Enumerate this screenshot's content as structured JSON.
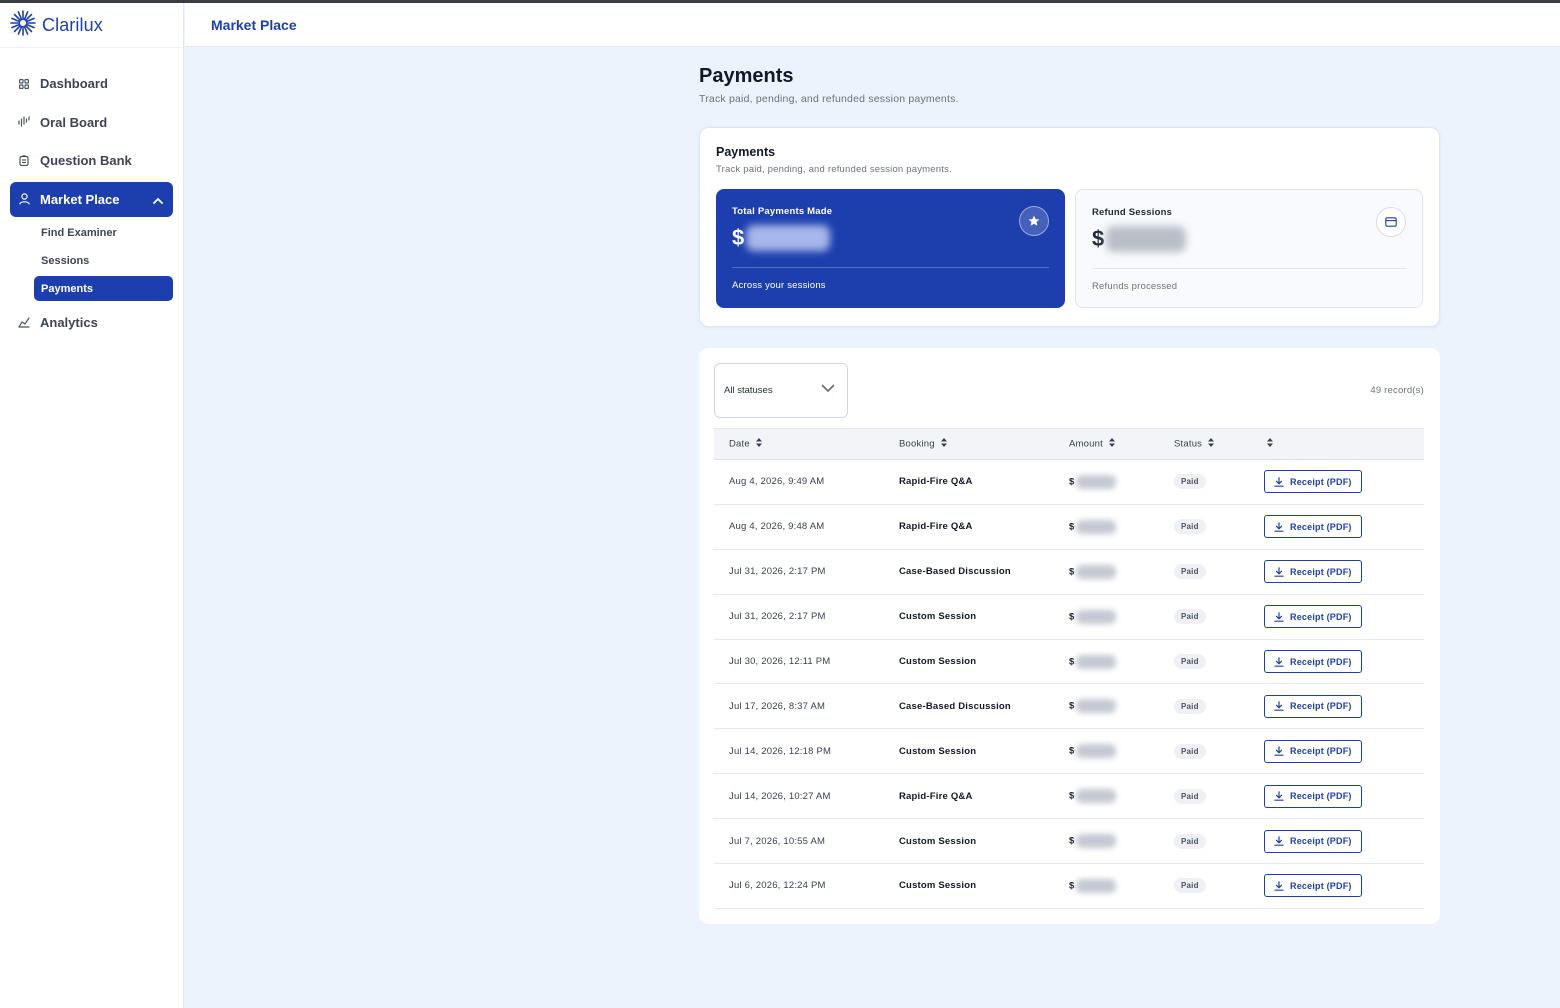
{
  "brand": {
    "name": "Clarilux",
    "logo_icon": "sunburst-logo-icon"
  },
  "sidebar": {
    "items": [
      {
        "label": "Dashboard",
        "icon": "grid-icon"
      },
      {
        "label": "Oral Board",
        "icon": "waveform-icon"
      },
      {
        "label": "Question Bank",
        "icon": "clipboard-icon"
      },
      {
        "label": "Market Place",
        "icon": "user-icon",
        "expanded": true
      },
      {
        "label": "Analytics",
        "icon": "analytics-icon"
      }
    ],
    "subitems": [
      {
        "label": "Find Examiner"
      },
      {
        "label": "Sessions"
      },
      {
        "label": "Payments",
        "active": true
      }
    ]
  },
  "header": {
    "title": "Market Place"
  },
  "page": {
    "title": "Payments",
    "subtitle": "Track paid, pending, and refunded session payments."
  },
  "summary": {
    "title": "Payments",
    "subtitle": "Track paid, pending, and refunded session payments.",
    "total": {
      "label": "Total Payments Made",
      "currency": "$",
      "foot": "Across your sessions",
      "icon": "star-icon"
    },
    "refund": {
      "label": "Refund Sessions",
      "currency": "$",
      "foot": "Refunds processed",
      "icon": "card-icon"
    }
  },
  "filter": {
    "value": "All statuses",
    "records": "49 record(s)"
  },
  "table": {
    "headers": {
      "date": "Date",
      "booking": "Booking",
      "amount": "Amount",
      "status": "Status"
    },
    "rows": [
      {
        "date": "Aug 4, 2026, 9:49 AM",
        "booking": "Rapid-Fire Q&A",
        "currency": "$",
        "status": "Paid",
        "action": "Receipt (PDF)"
      },
      {
        "date": "Aug 4, 2026, 9:48 AM",
        "booking": "Rapid-Fire Q&A",
        "currency": "$",
        "status": "Paid",
        "action": "Receipt (PDF)"
      },
      {
        "date": "Jul 31, 2026, 2:17 PM",
        "booking": "Case-Based Discussion",
        "currency": "$",
        "status": "Paid",
        "action": "Receipt (PDF)"
      },
      {
        "date": "Jul 31, 2026, 2:17 PM",
        "booking": "Custom Session",
        "currency": "$",
        "status": "Paid",
        "action": "Receipt (PDF)"
      },
      {
        "date": "Jul 30, 2026, 12:11 PM",
        "booking": "Custom Session",
        "currency": "$",
        "status": "Paid",
        "action": "Receipt (PDF)"
      },
      {
        "date": "Jul 17, 2026, 8:37 AM",
        "booking": "Case-Based Discussion",
        "currency": "$",
        "status": "Paid",
        "action": "Receipt (PDF)"
      },
      {
        "date": "Jul 14, 2026, 12:18 PM",
        "booking": "Custom Session",
        "currency": "$",
        "status": "Paid",
        "action": "Receipt (PDF)"
      },
      {
        "date": "Jul 14, 2026, 10:27 AM",
        "booking": "Rapid-Fire Q&A",
        "currency": "$",
        "status": "Paid",
        "action": "Receipt (PDF)"
      },
      {
        "date": "Jul 7, 2026, 10:55 AM",
        "booking": "Custom Session",
        "currency": "$",
        "status": "Paid",
        "action": "Receipt (PDF)"
      },
      {
        "date": "Jul 6, 2026, 12:24 PM",
        "booking": "Custom Session",
        "currency": "$",
        "status": "Paid",
        "action": "Receipt (PDF)"
      }
    ]
  },
  "colors": {
    "primary": "#1d3fae",
    "background": "#edf3fd"
  }
}
